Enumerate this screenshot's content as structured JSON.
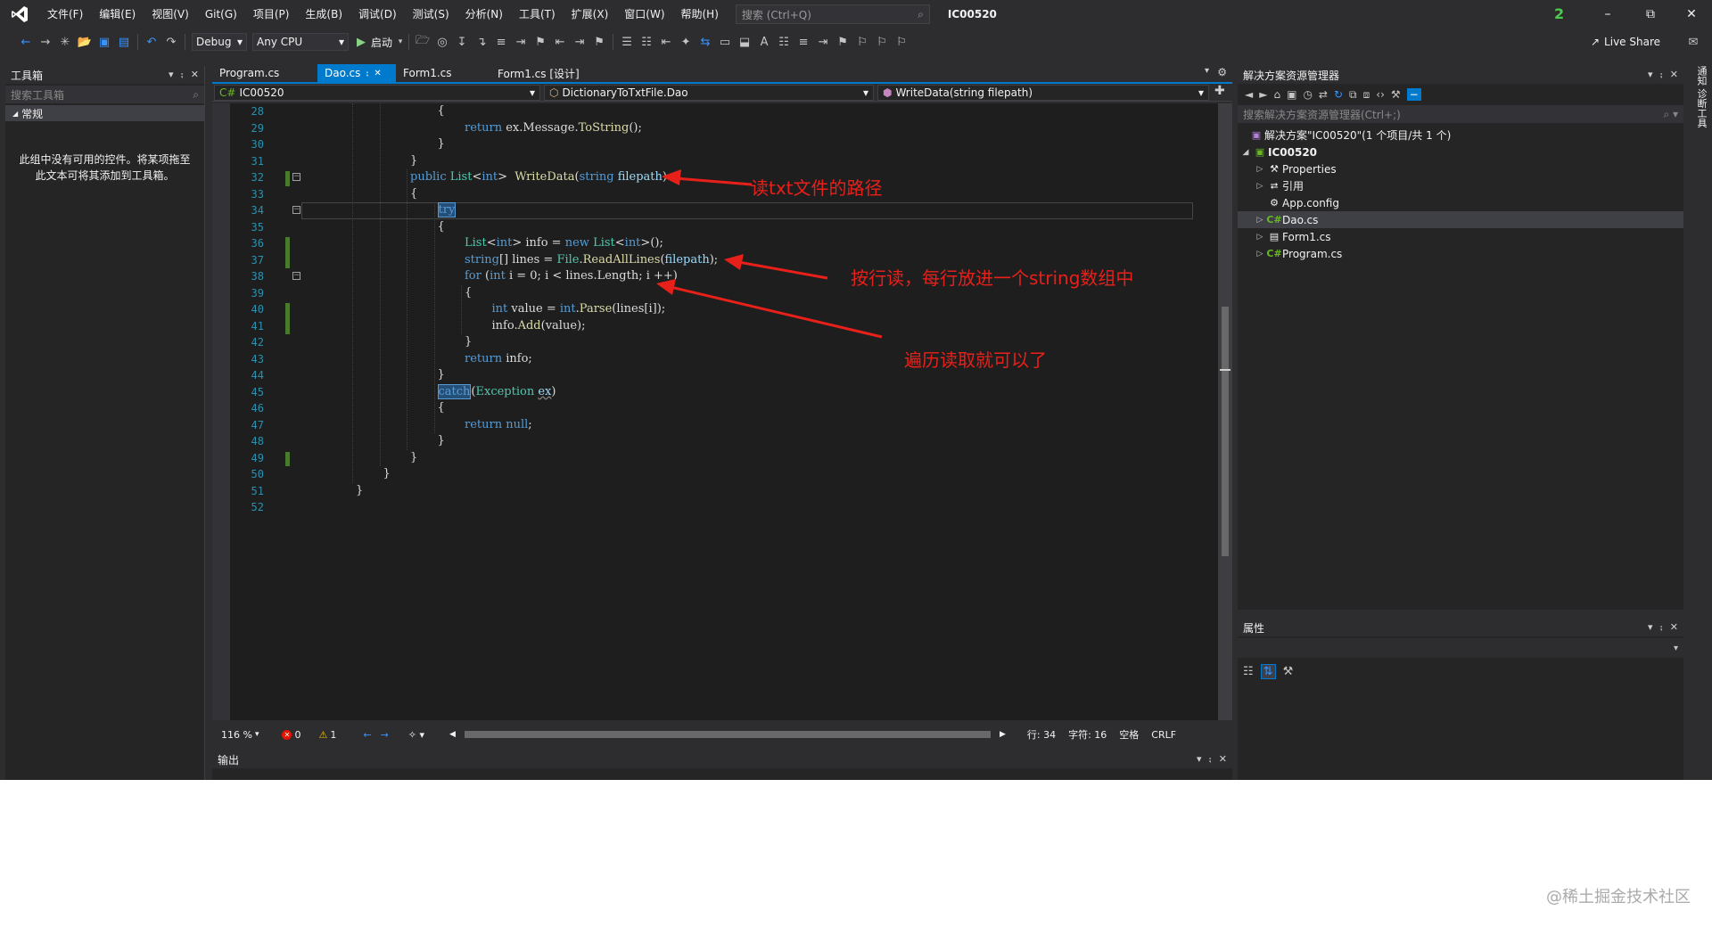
{
  "window": {
    "menu": [
      "文件(F)",
      "编辑(E)",
      "视图(V)",
      "Git(G)",
      "项目(P)",
      "生成(B)",
      "调试(D)",
      "测试(S)",
      "分析(N)",
      "工具(T)",
      "扩展(X)",
      "窗口(W)",
      "帮助(H)"
    ],
    "search_placeholder": "搜索 (Ctrl+Q)",
    "solution_name": "IC00520",
    "notification_count": "2"
  },
  "toolbar": {
    "config": "Debug",
    "platform": "Any CPU",
    "start_label": "启动",
    "live_share": "Live Share"
  },
  "toolbox": {
    "title": "工具箱",
    "search_placeholder": "搜索工具箱",
    "group": "常规",
    "empty_message": "此组中没有可用的控件。将某项拖至此文本可将其添加到工具箱。"
  },
  "editor": {
    "tabs": [
      {
        "label": "Program.cs"
      },
      {
        "label": "Dao.cs"
      },
      {
        "label": "Form1.cs"
      },
      {
        "label": "Form1.cs [设计]"
      }
    ],
    "nav": {
      "project": "IC00520",
      "class": "DictionaryToTxtFile.Dao",
      "member": "WriteData(string filepath)"
    },
    "lines": [
      {
        "n": "28",
        "indent": 5,
        "text": "{"
      },
      {
        "n": "29",
        "indent": 6,
        "text": "return ex.Message.ToString();"
      },
      {
        "n": "30",
        "indent": 5,
        "text": "}"
      },
      {
        "n": "31",
        "indent": 4,
        "text": "}"
      },
      {
        "n": "32",
        "indent": 4,
        "text": "public List<int>  WriteData(string filepath)"
      },
      {
        "n": "33",
        "indent": 4,
        "text": "{"
      },
      {
        "n": "34",
        "indent": 5,
        "text": "try"
      },
      {
        "n": "35",
        "indent": 5,
        "text": "{"
      },
      {
        "n": "36",
        "indent": 6,
        "text": "List<int> info = new List<int>();"
      },
      {
        "n": "37",
        "indent": 6,
        "text": "string[] lines = File.ReadAllLines(filepath);"
      },
      {
        "n": "38",
        "indent": 6,
        "text": "for (int i = 0; i < lines.Length; i ++)"
      },
      {
        "n": "39",
        "indent": 6,
        "text": "{"
      },
      {
        "n": "40",
        "indent": 7,
        "text": "int value = int.Parse(lines[i]);"
      },
      {
        "n": "41",
        "indent": 7,
        "text": "info.Add(value);"
      },
      {
        "n": "42",
        "indent": 6,
        "text": "}"
      },
      {
        "n": "43",
        "indent": 6,
        "text": "return info;"
      },
      {
        "n": "44",
        "indent": 5,
        "text": "}"
      },
      {
        "n": "45",
        "indent": 5,
        "text": "catch(Exception ex)"
      },
      {
        "n": "46",
        "indent": 5,
        "text": "{"
      },
      {
        "n": "47",
        "indent": 6,
        "text": "return null;"
      },
      {
        "n": "48",
        "indent": 5,
        "text": "}"
      },
      {
        "n": "49",
        "indent": 4,
        "text": "}"
      },
      {
        "n": "50",
        "indent": 3,
        "text": "}"
      },
      {
        "n": "51",
        "indent": 2,
        "text": "}"
      },
      {
        "n": "52",
        "indent": 0,
        "text": ""
      }
    ]
  },
  "status": {
    "zoom": "116 %",
    "errors": "0",
    "warnings": "1",
    "line": "行: 34",
    "char": "字符: 16",
    "spaces": "空格",
    "eol": "CRLF"
  },
  "output": {
    "title": "输出"
  },
  "solution_explorer": {
    "title": "解决方案资源管理器",
    "search_placeholder": "搜索解决方案资源管理器(Ctrl+;)",
    "solution": "解决方案\"IC00520\"(1 个项目/共 1 个)",
    "project": "IC00520",
    "items": [
      "Properties",
      "引用",
      "App.config",
      "Dao.cs",
      "Form1.cs",
      "Program.cs"
    ]
  },
  "properties": {
    "title": "属性"
  },
  "right_rail": {
    "label": "通知 诊断工具"
  },
  "annotations": {
    "path_note": "读txt文件的路径",
    "read_lines_note": "按行读，每行放进一个string数组中",
    "loop_note": "遍历读取就可以了"
  },
  "watermark": "@稀土掘金技术社区",
  "colors": {
    "accent": "#007acc",
    "annotation": "#e8201a",
    "keyword": "#569cd6",
    "type": "#4ec9b0",
    "method": "#dcdcaa",
    "line_number": "#2b91af"
  }
}
